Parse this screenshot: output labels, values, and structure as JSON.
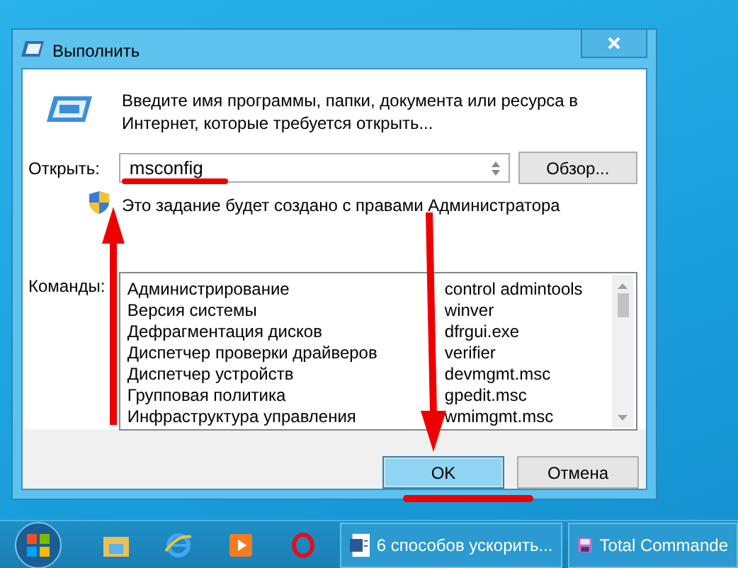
{
  "window": {
    "title": "Выполнить"
  },
  "description": "Введите имя программы, папки, документа или ресурса в Интернет, которые требуется открыть...",
  "open_label": "Открыть:",
  "open_field": {
    "value": "msconfig"
  },
  "browse_button": "Обзор...",
  "admin_note": "Это задание будет создано с правами Администратора",
  "commands_label": "Команды:",
  "commands": [
    {
      "name": "Администрирование",
      "command": "control admintools"
    },
    {
      "name": "Версия системы",
      "command": "winver"
    },
    {
      "name": "Дефрагментация дисков",
      "command": "dfrgui.exe"
    },
    {
      "name": "Диспетчер проверки драйверов",
      "command": "verifier"
    },
    {
      "name": "Диспетчер устройств",
      "command": "devmgmt.msc"
    },
    {
      "name": "Групповая политика",
      "command": "gpedit.msc"
    },
    {
      "name": "Инфраструктура управления",
      "command": "wmimgmt.msc"
    }
  ],
  "buttons": [
    {
      "label": "OK",
      "selected": true
    },
    {
      "label": "Отмена",
      "selected": false
    }
  ],
  "taskbar": {
    "tasks": [
      {
        "label": "6 способов ускорить...",
        "kind": "document"
      },
      {
        "label": "Total Commande",
        "kind": "disk"
      }
    ]
  }
}
